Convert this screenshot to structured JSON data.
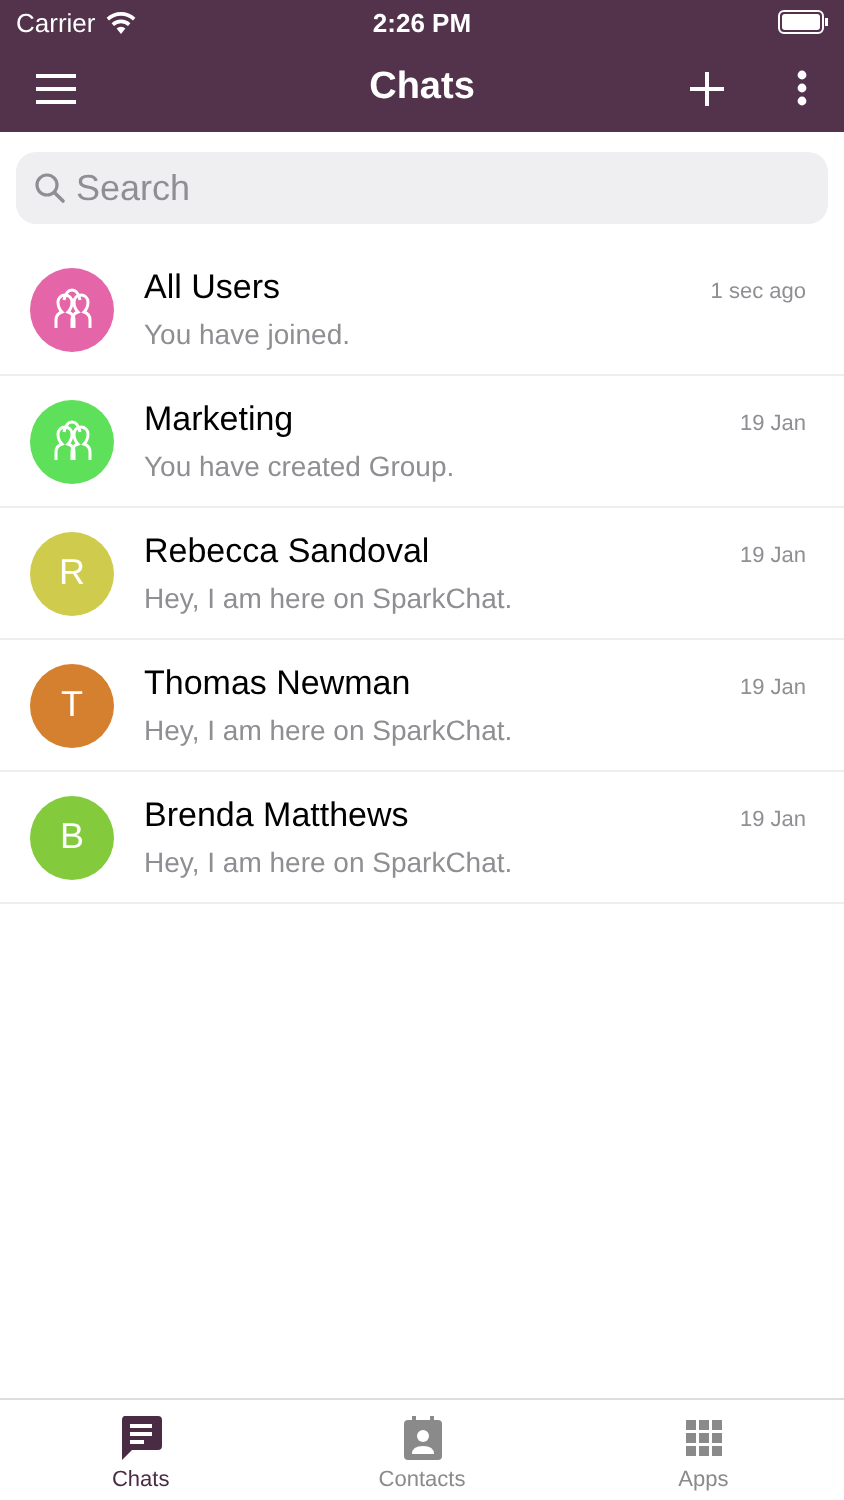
{
  "status_bar": {
    "carrier": "Carrier",
    "time": "2:26 PM"
  },
  "nav": {
    "title": "Chats"
  },
  "search": {
    "placeholder": "Search"
  },
  "chats": [
    {
      "name": "All Users",
      "message": "You have joined.",
      "time": "1 sec ago",
      "avatar": {
        "kind": "group",
        "color": "#e465a8"
      }
    },
    {
      "name": "Marketing",
      "message": "You have created Group.",
      "time": "19 Jan",
      "avatar": {
        "kind": "group",
        "color": "#5ee05a"
      }
    },
    {
      "name": "Rebecca Sandoval",
      "message": "Hey, I am here on SparkChat.",
      "time": "19 Jan",
      "avatar": {
        "kind": "letter",
        "letter": "R",
        "color": "#cfcc4d"
      }
    },
    {
      "name": "Thomas Newman",
      "message": "Hey, I am here on SparkChat.",
      "time": "19 Jan",
      "avatar": {
        "kind": "letter",
        "letter": "T",
        "color": "#d4802f"
      }
    },
    {
      "name": "Brenda Matthews",
      "message": "Hey, I am here on SparkChat.",
      "time": "19 Jan",
      "avatar": {
        "kind": "letter",
        "letter": "B",
        "color": "#83cb3d"
      }
    }
  ],
  "tabs": [
    {
      "label": "Chats",
      "kind": "chats",
      "selected": true
    },
    {
      "label": "Contacts",
      "kind": "contacts",
      "selected": false
    },
    {
      "label": "Apps",
      "kind": "apps",
      "selected": false
    }
  ]
}
